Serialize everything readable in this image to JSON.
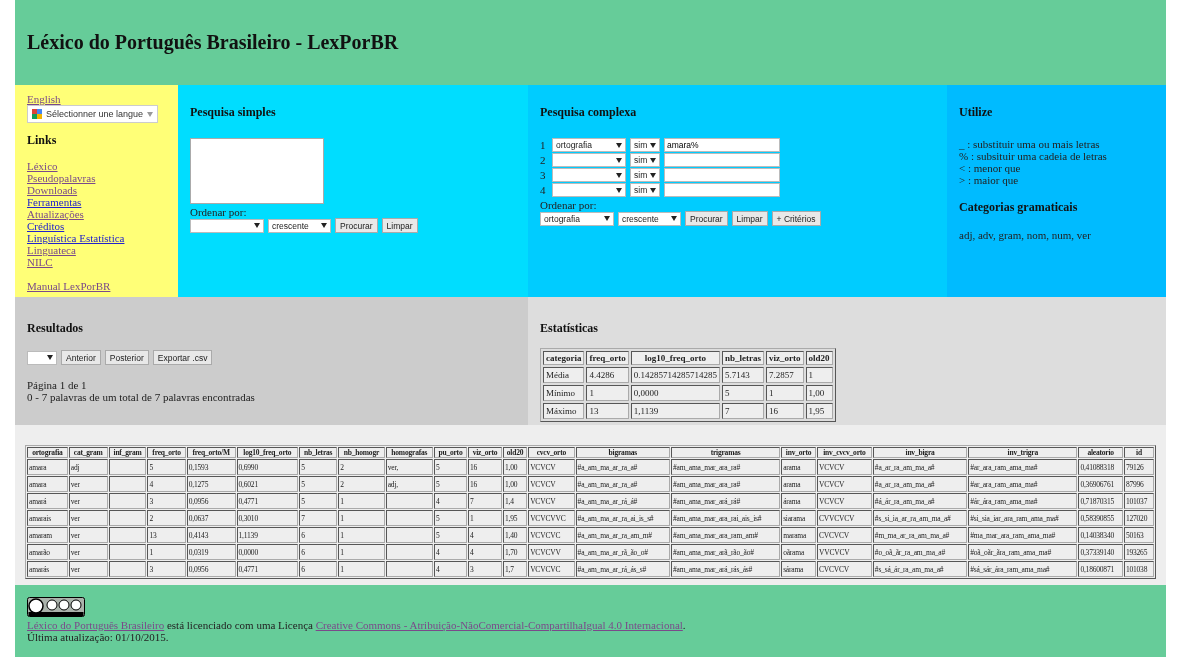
{
  "header": {
    "title": "Léxico do Português Brasileiro - LexPorBR"
  },
  "sidebar": {
    "language_link": "English",
    "translate_widget": "Sélectionner une langue",
    "links_title": "Links",
    "links": [
      {
        "label": "Léxico",
        "visited": true
      },
      {
        "label": "Pseudopalavras",
        "visited": true
      },
      {
        "label": "Downloads",
        "visited": true
      },
      {
        "label": "Ferramentas",
        "visited": false
      },
      {
        "label": "Atualizações",
        "visited": true
      },
      {
        "label": "Créditos",
        "visited": false
      },
      {
        "label": "Linguística Estatística",
        "visited": false
      },
      {
        "label": "Linguateca",
        "visited": true
      },
      {
        "label": "NILC",
        "visited": true
      }
    ],
    "manual_link": "Manual LexPorBR"
  },
  "simple_search": {
    "title": "Pesquisa simples",
    "sort_label": "Ordenar por:",
    "sort_order": "crescente",
    "buttons": [
      "Procurar",
      "Limpar"
    ]
  },
  "complex_search": {
    "title": "Pesquisa complexa",
    "criteria": [
      {
        "number": "1",
        "field": "ortografia",
        "match": "sim",
        "value": "amara%"
      },
      {
        "number": "2",
        "match": "sim"
      },
      {
        "number": "3",
        "match": "sim"
      },
      {
        "number": "4",
        "match": "sim"
      }
    ],
    "sort_label": "Ordenar por:",
    "sort_field": "ortografia",
    "sort_order": "crescente",
    "buttons": [
      "Procurar",
      "Limpar",
      "+ Critérios"
    ]
  },
  "help": {
    "title": "Utilize",
    "items": [
      "_ : substituir uma ou mais letras",
      "% : subsituir uma cadeia de letras",
      "< : menor que",
      "> : maior que"
    ],
    "categories_title": "Categorias gramaticais",
    "categories_text": "adj, adv, gram, nom, num, ver"
  },
  "results": {
    "title": "Resultados",
    "buttons": [
      "Anterior",
      "Posterior",
      "Exportar .csv"
    ],
    "page_info": "Página 1 de 1",
    "count_text": "0 - 7 palavras de um total de 7 palavras encontradas"
  },
  "statistics": {
    "title": "Estatísticas",
    "columns": [
      "categoria",
      "freq_orto",
      "log10_freq_orto",
      "nb_letras",
      "viz_orto",
      "old20"
    ],
    "rows": [
      [
        "Média",
        "4.4286",
        "0.14285714285714285",
        "5.7143",
        "7.2857",
        "1"
      ],
      [
        "Mínimo",
        "1",
        "0,0000",
        "5",
        "1",
        "1,00"
      ],
      [
        "Máximo",
        "13",
        "1,1139",
        "7",
        "16",
        "1,95"
      ]
    ]
  },
  "table": {
    "columns": [
      "ortografia",
      "cat_gram",
      "inf_gram",
      "freq_orto",
      "freq_orto/M",
      "log10_freq_orto",
      "nb_letras",
      "nb_homogr",
      "homografas",
      "pu_orto",
      "viz_orto",
      "old20",
      "cvcv_orto",
      "bigramas",
      "trigramas",
      "inv_orto",
      "inv_cvcv_orto",
      "inv_bigra",
      "inv_trigra",
      "aleatorio",
      "id"
    ],
    "rows": [
      [
        "amara",
        "adj",
        "",
        "5",
        "0,1593",
        "0,6990",
        "5",
        "2",
        "ver,",
        "5",
        "16",
        "1,00",
        "VCVCV",
        "#a_am_ma_ar_ra_a#",
        "#am_ama_mar_ara_ra#",
        "arama",
        "VCVCV",
        "#a_ar_ra_am_ma_a#",
        "#ar_ara_ram_ama_ma#",
        "0,41088318",
        "79126"
      ],
      [
        "amara",
        "ver",
        "",
        "4",
        "0,1275",
        "0,6021",
        "5",
        "2",
        "adj,",
        "5",
        "16",
        "1,00",
        "VCVCV",
        "#a_am_ma_ar_ra_a#",
        "#am_ama_mar_ara_ra#",
        "arama",
        "VCVCV",
        "#a_ar_ra_am_ma_a#",
        "#ar_ara_ram_ama_ma#",
        "0,36906761",
        "87996"
      ],
      [
        "amará",
        "ver",
        "",
        "3",
        "0,0956",
        "0,4771",
        "5",
        "1",
        "",
        "4",
        "7",
        "1,4",
        "VCVCV",
        "#a_am_ma_ar_rá_á#",
        "#am_ama_mar_ará_rá#",
        "árama",
        "VCVCV",
        "#á_ár_ra_am_ma_a#",
        "#ár_ára_ram_ama_ma#",
        "0,71870315",
        "101037"
      ],
      [
        "amarais",
        "ver",
        "",
        "2",
        "0,0637",
        "0,3010",
        "7",
        "1",
        "",
        "5",
        "1",
        "1,95",
        "VCVCVVC",
        "#a_am_ma_ar_ra_ai_is_s#",
        "#am_ama_mar_ara_rai_ais_is#",
        "siarama",
        "CVVCVCV",
        "#s_si_ia_ar_ra_am_ma_a#",
        "#si_sia_iar_ara_ram_ama_ma#",
        "0,58390855",
        "127020"
      ],
      [
        "amaram",
        "ver",
        "",
        "13",
        "0,4143",
        "1,1139",
        "6",
        "1",
        "",
        "5",
        "4",
        "1,40",
        "VCVCVC",
        "#a_am_ma_ar_ra_am_m#",
        "#am_ama_mar_ara_ram_am#",
        "marama",
        "CVCVCV",
        "#m_ma_ar_ra_am_ma_a#",
        "#ma_mar_ara_ram_ama_ma#",
        "0,14038340",
        "50163"
      ],
      [
        "amarão",
        "ver",
        "",
        "1",
        "0,0319",
        "0,0000",
        "6",
        "1",
        "",
        "4",
        "4",
        "1,70",
        "VCVCVV",
        "#a_am_ma_ar_rã_ão_o#",
        "#am_ama_mar_arã_rão_ão#",
        "oãrama",
        "VVCVCV",
        "#o_oã_ãr_ra_am_ma_a#",
        "#oã_oãr_ãra_ram_ama_ma#",
        "0,37339140",
        "193265"
      ],
      [
        "amarás",
        "ver",
        "",
        "3",
        "0,0956",
        "0,4771",
        "6",
        "1",
        "",
        "4",
        "3",
        "1,7",
        "VCVCVC",
        "#a_am_ma_ar_rá_ás_s#",
        "#am_ama_mar_ará_rás_ás#",
        "sárama",
        "CVCVCV",
        "#s_sá_ár_ra_am_ma_a#",
        "#sá_sár_ára_ram_ama_ma#",
        "0,18600871",
        "101038"
      ]
    ]
  },
  "footer": {
    "site_link": "Léxico do Português Brasileiro",
    "license_text": " está licenciado com uma Licença ",
    "license_link": "Creative Commons - Atribuição-NãoComercial-CompartilhaIgual 4.0 Internacional",
    "license_end": ".",
    "updated": "Última atualização: 01/10/2015."
  }
}
